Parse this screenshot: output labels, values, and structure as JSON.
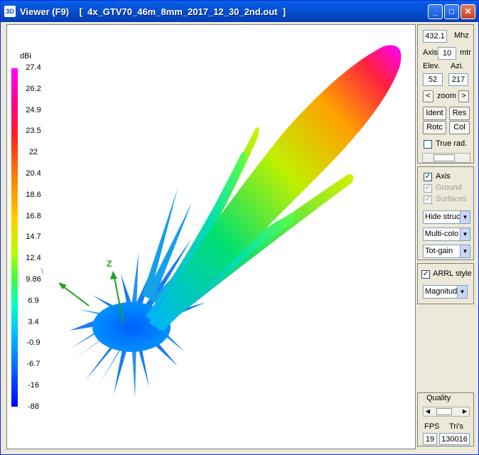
{
  "window": {
    "icon_text": "3D",
    "title": "Viewer (F9)    [  4x_GTV70_46m_8mm_2017_12_30_2nd.out  ]",
    "minimize": "_",
    "maximize": "□",
    "close": "✕"
  },
  "scale": {
    "unit": "dBi",
    "labels": [
      "27.4",
      "26.2",
      "24.9",
      "23.5",
      "22",
      "20.4",
      "18.6",
      "16.8",
      "14.7",
      "12.4",
      "9.86",
      "6.9",
      "3.4",
      "-0.9",
      "-6.7",
      "-16",
      "-88"
    ]
  },
  "controls": {
    "freq_value": "432.1",
    "freq_unit": "Mhz",
    "axis_label": "Axis",
    "axis_value": "10",
    "axis_unit": "mtr",
    "elev_label": "Elev.",
    "azi_label": "Azi.",
    "elev_value": "52",
    "azi_value": "217",
    "zoom_label": "zoom",
    "zoom_left": "<",
    "zoom_right": ">",
    "ident": "Ident",
    "res": "Res",
    "rotc": "Rotc",
    "col": "Col",
    "true_rad": "True rad.",
    "axis_chk": "Axis",
    "ground_chk": "Ground",
    "surfaces_chk": "Surfaces",
    "hide_struc": "Hide struc",
    "multi_color": "Multi-colo",
    "tot_gain": "Tot-gain",
    "arrl_style": "ARRL style",
    "magnitude": "Magnitud",
    "quality_label": "Quality",
    "fps_label": "FPS",
    "tris_label": "Tri's",
    "fps_value": "19",
    "tris_value": "130016"
  },
  "colors": {
    "titlebar": "#0553d8",
    "scale_top": "#ff00ff",
    "scale_bottom": "#0000ff"
  }
}
